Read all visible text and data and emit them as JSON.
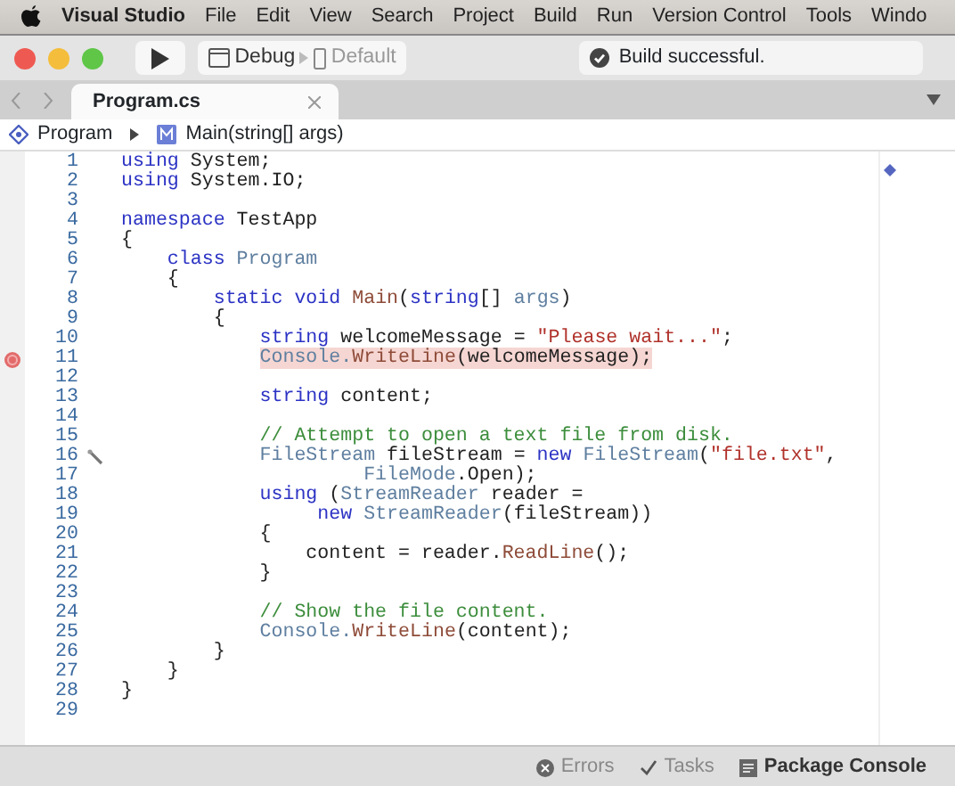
{
  "menu_bar": {
    "app": "Visual Studio",
    "items": [
      "File",
      "Edit",
      "View",
      "Search",
      "Project",
      "Build",
      "Run",
      "Version Control",
      "Tools",
      "Windo"
    ]
  },
  "toolbar": {
    "configuration": "Debug",
    "device": "Default",
    "status": "Build successful."
  },
  "tabs": [
    {
      "label": "Program.cs",
      "selected": true
    }
  ],
  "breadcrumb": {
    "class_name": "Program",
    "method": "Main(string[] args)"
  },
  "code_lines": [
    {
      "number": "1",
      "tokens": [
        {
          "kind": "keyword",
          "t": "using"
        },
        {
          "kind": "plain",
          "t": " System;"
        }
      ]
    },
    {
      "number": "2",
      "tokens": [
        {
          "kind": "keyword",
          "t": "using"
        },
        {
          "kind": "plain",
          "t": " System.IO;"
        }
      ]
    },
    {
      "number": "3"
    },
    {
      "number": "4",
      "tokens": [
        {
          "kind": "keyword",
          "t": "namespace"
        },
        {
          "kind": "plain",
          "t": " TestApp"
        }
      ]
    },
    {
      "number": "5",
      "tokens": [
        {
          "kind": "plain",
          "t": "{"
        }
      ]
    },
    {
      "number": "6",
      "tokens": [
        {
          "kind": "keyword",
          "t": "    class"
        },
        {
          "kind": "type",
          "t": " Program"
        }
      ]
    },
    {
      "number": "7",
      "tokens": [
        {
          "kind": "plain",
          "t": "    {"
        }
      ]
    },
    {
      "number": "8",
      "tokens": [
        {
          "kind": "keyword",
          "t": "        static void"
        },
        {
          "kind": "method",
          "t": " Main"
        },
        {
          "kind": "plain",
          "t": "("
        },
        {
          "kind": "keyword",
          "t": "string"
        },
        {
          "kind": "plain",
          "t": "[]"
        },
        {
          "kind": "type",
          "t": " args"
        },
        {
          "kind": "plain",
          "t": ")"
        }
      ]
    },
    {
      "number": "9",
      "tokens": [
        {
          "kind": "plain",
          "t": "        {"
        }
      ]
    },
    {
      "number": "10",
      "tokens": [
        {
          "kind": "keyword",
          "t": "            string"
        },
        {
          "kind": "plain",
          "t": " welcomeMessage ="
        },
        {
          "kind": "string",
          "t": " \"Please wait...\""
        },
        {
          "kind": "plain",
          "t": ";"
        }
      ]
    },
    {
      "number": "11",
      "breakpoint": true,
      "tokens": [
        {
          "kind": "type",
          "t": "            Console."
        },
        {
          "kind": "method",
          "t": "WriteLine"
        },
        {
          "kind": "plain",
          "t": "(welcomeMessage);"
        }
      ]
    },
    {
      "number": "12"
    },
    {
      "number": "13",
      "tokens": [
        {
          "kind": "keyword",
          "t": "            string"
        },
        {
          "kind": "plain",
          "t": " content;"
        }
      ]
    },
    {
      "number": "14"
    },
    {
      "number": "15",
      "tokens": [
        {
          "kind": "comment",
          "t": "            // Attempt to open a text file from disk."
        }
      ]
    },
    {
      "number": "16",
      "fix_marker": true,
      "tokens": [
        {
          "kind": "type",
          "t": "            FileStream"
        },
        {
          "kind": "plain",
          "t": " fileStream ="
        },
        {
          "kind": "keyword",
          "t": " new"
        },
        {
          "kind": "type",
          "t": " FileStream"
        },
        {
          "kind": "plain",
          "t": "("
        },
        {
          "kind": "string",
          "t": "\"file.txt\""
        },
        {
          "kind": "plain",
          "t": ","
        }
      ]
    },
    {
      "number": "17",
      "tokens": [
        {
          "kind": "type",
          "t": "                     FileMode"
        },
        {
          "kind": "plain",
          "t": ".Open);"
        }
      ]
    },
    {
      "number": "18",
      "tokens": [
        {
          "kind": "keyword",
          "t": "            using"
        },
        {
          "kind": "plain",
          "t": " ("
        },
        {
          "kind": "type",
          "t": "StreamReader"
        },
        {
          "kind": "plain",
          "t": " reader ="
        }
      ]
    },
    {
      "number": "19",
      "tokens": [
        {
          "kind": "keyword",
          "t": "                 new"
        },
        {
          "kind": "type",
          "t": " StreamReader"
        },
        {
          "kind": "plain",
          "t": "(fileStream))"
        }
      ]
    },
    {
      "number": "20",
      "tokens": [
        {
          "kind": "plain",
          "t": "            {"
        }
      ]
    },
    {
      "number": "21",
      "tokens": [
        {
          "kind": "plain",
          "t": "                content = reader."
        },
        {
          "kind": "method",
          "t": "ReadLine"
        },
        {
          "kind": "plain",
          "t": "();"
        }
      ]
    },
    {
      "number": "22",
      "tokens": [
        {
          "kind": "plain",
          "t": "            }"
        }
      ]
    },
    {
      "number": "23"
    },
    {
      "number": "24",
      "tokens": [
        {
          "kind": "comment",
          "t": "            // Show the file content."
        }
      ]
    },
    {
      "number": "25",
      "tokens": [
        {
          "kind": "type",
          "t": "            Console."
        },
        {
          "kind": "method",
          "t": "WriteLine"
        },
        {
          "kind": "plain",
          "t": "(content);"
        }
      ]
    },
    {
      "number": "26",
      "tokens": [
        {
          "kind": "plain",
          "t": "        }"
        }
      ]
    },
    {
      "number": "27",
      "tokens": [
        {
          "kind": "plain",
          "t": "    }"
        }
      ]
    },
    {
      "number": "28",
      "tokens": [
        {
          "kind": "plain",
          "t": "}"
        }
      ]
    },
    {
      "number": "29"
    }
  ],
  "status_bar": [
    {
      "kind": "errors",
      "label": "Errors",
      "selected": false
    },
    {
      "kind": "tasks",
      "label": "Tasks",
      "selected": false
    },
    {
      "kind": "console",
      "label": "Package Console",
      "selected": true
    }
  ]
}
